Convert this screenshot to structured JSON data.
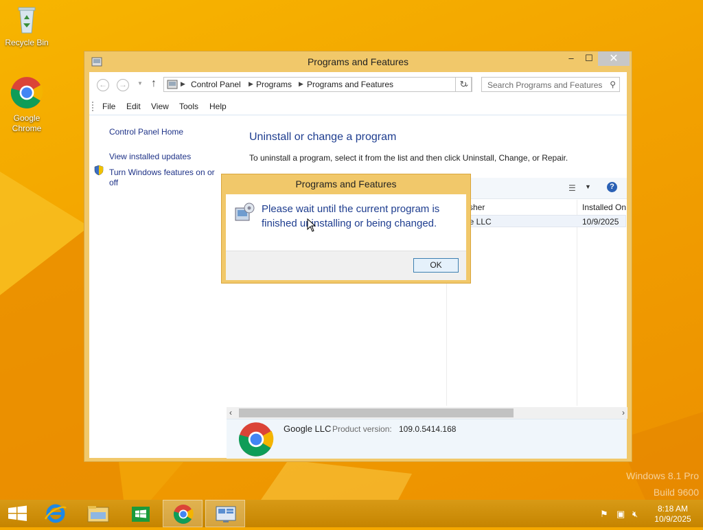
{
  "desktop": {
    "icons": [
      {
        "label": "Recycle Bin"
      },
      {
        "label": "Google Chrome"
      }
    ],
    "watermark": {
      "line1": "Windows 8.1 Pro",
      "line2": "Build 9600"
    }
  },
  "window": {
    "title": "Programs and Features",
    "buttons": {
      "minimize": "–",
      "maximize": "☐",
      "close": "✕"
    },
    "address": {
      "crumbs": [
        "Control Panel",
        "Programs",
        "Programs and Features"
      ]
    },
    "search": {
      "placeholder": "Search Programs and Features"
    },
    "menu": [
      "File",
      "Edit",
      "View",
      "Tools",
      "Help"
    ],
    "sidebar": {
      "links": [
        "Control Panel Home",
        "View installed updates",
        "Turn Windows features on or off"
      ]
    },
    "main": {
      "heading": "Uninstall or change a program",
      "instruction": "To uninstall a program, select it from the list and then click Uninstall, Change, or Repair.",
      "columns": {
        "publisher_partial": "sher",
        "installed_on": "Installed On"
      },
      "rows": [
        {
          "publisher_partial": "le LLC",
          "installed_on": "10/9/2025"
        }
      ]
    },
    "details": {
      "publisher": "Google LLC",
      "version_label": "Product version:",
      "version_value": "109.0.5414.168"
    }
  },
  "dialog": {
    "title": "Programs and Features",
    "message": "Please wait until the current program is finished uninstalling or being changed.",
    "ok_label": "OK"
  },
  "taskbar": {
    "clock": {
      "time": "8:18 AM",
      "date": "10/9/2025"
    }
  },
  "colors": {
    "desktop": "#f2a100",
    "window_frame": "#f1c86a",
    "link_blue": "#1e3287",
    "heading_blue": "#1e3d8f"
  }
}
